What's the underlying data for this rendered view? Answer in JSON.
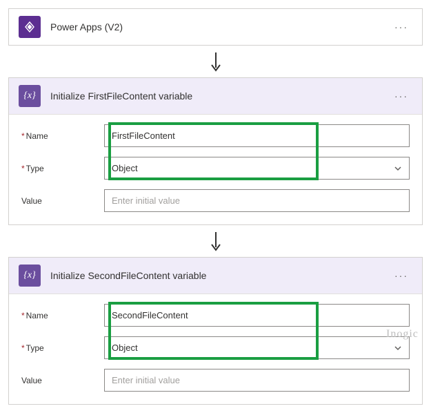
{
  "trigger": {
    "title": "Power Apps (V2)"
  },
  "action1": {
    "title": "Initialize FirstFileContent variable",
    "name_label": "Name",
    "name_value": "FirstFileContent",
    "type_label": "Type",
    "type_value": "Object",
    "value_label": "Value",
    "value_placeholder": "Enter initial value"
  },
  "action2": {
    "title": "Initialize SecondFileContent variable",
    "name_label": "Name",
    "name_value": "SecondFileContent",
    "type_label": "Type",
    "type_value": "Object",
    "value_label": "Value",
    "value_placeholder": "Enter initial value"
  },
  "icons": {
    "var": "{x}"
  },
  "watermark": "Inogic"
}
